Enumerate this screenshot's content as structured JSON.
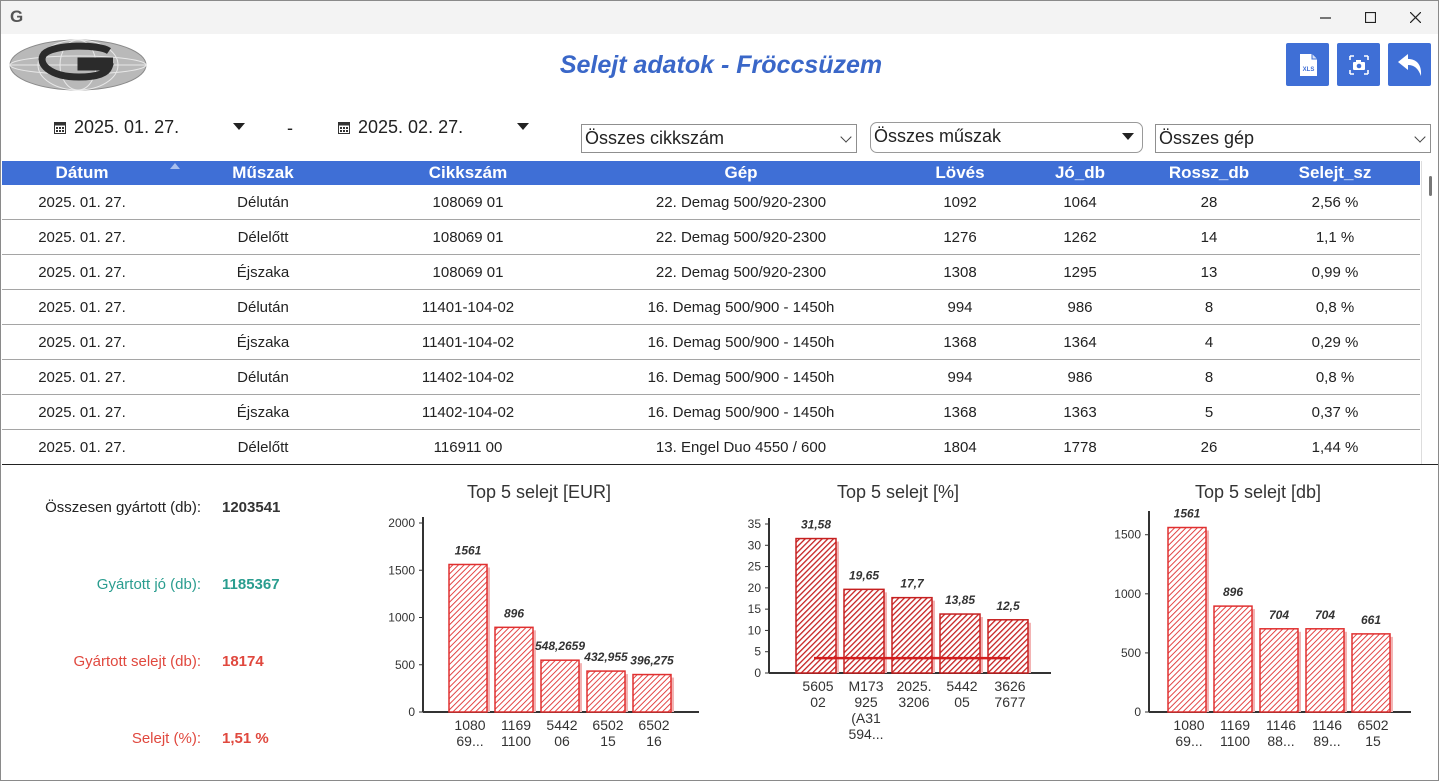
{
  "window": {
    "app_icon": "G",
    "minimize_icon": "minimize-icon",
    "maximize_icon": "maximize-icon",
    "close_icon": "close-icon"
  },
  "header": {
    "title": "Selejt adatok - Fröccsüzem",
    "logo": "company-globe-logo",
    "buttons": [
      {
        "name": "export-xls-button",
        "icon": "xls-icon",
        "label": "XLS"
      },
      {
        "name": "screenshot-button",
        "icon": "camera-icon"
      },
      {
        "name": "back-button",
        "icon": "undo-arrow-icon"
      }
    ],
    "accent_color": "#3f6fd6"
  },
  "filters": {
    "date_from": "2025. 01. 27.",
    "separator": "-",
    "date_to": "2025. 02. 27.",
    "part_number": "Összes cikkszám",
    "shift": "Összes műszak",
    "machine": "Összes gép"
  },
  "table": {
    "columns": [
      "Dátum",
      "Műszak",
      "Cikkszám",
      "Gép",
      "Lövés",
      "Jó_db",
      "Rossz_db",
      "Selejt_sz"
    ],
    "rows": [
      [
        "2025. 01. 27.",
        "Délután",
        "108069 01",
        "22. Demag 500/920-2300",
        "1092",
        "1064",
        "28",
        "2,56 %"
      ],
      [
        "2025. 01. 27.",
        "Délelőtt",
        "108069 01",
        "22. Demag 500/920-2300",
        "1276",
        "1262",
        "14",
        "1,1 %"
      ],
      [
        "2025. 01. 27.",
        "Éjszaka",
        "108069 01",
        "22. Demag 500/920-2300",
        "1308",
        "1295",
        "13",
        "0,99 %"
      ],
      [
        "2025. 01. 27.",
        "Délután",
        "11401-104-02",
        "16. Demag 500/900 - 1450h",
        "994",
        "986",
        "8",
        "0,8 %"
      ],
      [
        "2025. 01. 27.",
        "Éjszaka",
        "11401-104-02",
        "16. Demag 500/900 - 1450h",
        "1368",
        "1364",
        "4",
        "0,29 %"
      ],
      [
        "2025. 01. 27.",
        "Délután",
        "11402-104-02",
        "16. Demag 500/900 - 1450h",
        "994",
        "986",
        "8",
        "0,8 %"
      ],
      [
        "2025. 01. 27.",
        "Éjszaka",
        "11402-104-02",
        "16. Demag 500/900 - 1450h",
        "1368",
        "1363",
        "5",
        "0,37 %"
      ],
      [
        "2025. 01. 27.",
        "Délelőtt",
        "116911 00",
        "13. Engel Duo 4550 / 600",
        "1804",
        "1778",
        "26",
        "1,44 %"
      ]
    ]
  },
  "summary": {
    "total_label": "Összesen gyártott (db):",
    "total_value": "1203541",
    "good_label": "Gyártott jó (db):",
    "good_value": "1185367",
    "scrap_label": "Gyártott selejt (db):",
    "scrap_value": "18174",
    "pct_label": "Selejt (%):",
    "pct_value": "1,51 %",
    "colors": {
      "total": "#333333",
      "good": "#2a9d8f",
      "scrap": "#e0483e"
    }
  },
  "chart_data": [
    {
      "type": "bar",
      "title": "Top 5 selejt [EUR]",
      "categories": [
        [
          "1080",
          "69..."
        ],
        [
          "1169",
          "1100"
        ],
        [
          "5442",
          "06"
        ],
        [
          "6502",
          "15"
        ],
        [
          "6502",
          "16"
        ]
      ],
      "values": [
        1561,
        896,
        548.2659,
        432.955,
        396.275
      ],
      "labels": [
        "1561",
        "896",
        "548,2659",
        "432,955",
        "396,275"
      ],
      "yticks": [
        0,
        500,
        1000,
        1500,
        2000
      ],
      "ylim": [
        0,
        2000
      ],
      "bar_color": "#e03030"
    },
    {
      "type": "bar",
      "title": "Top 5 selejt [%]",
      "categories": [
        [
          "5605",
          "02"
        ],
        [
          "M173",
          "925",
          "(A31",
          "594..."
        ],
        [
          "2025.",
          "3206"
        ],
        [
          "5442",
          "05"
        ],
        [
          "3626",
          "7677"
        ]
      ],
      "values": [
        31.58,
        19.65,
        17.7,
        13.85,
        12.5
      ],
      "labels": [
        "31,58",
        "19,65",
        "17,7",
        "13,85",
        "12,5"
      ],
      "yticks": [
        0,
        5,
        10,
        15,
        20,
        25,
        30,
        35
      ],
      "ylim": [
        0,
        35
      ],
      "reference_line": 3.5,
      "bar_color": "#c62020"
    },
    {
      "type": "bar",
      "title": "Top 5 selejt [db]",
      "categories": [
        [
          "1080",
          "69..."
        ],
        [
          "1169",
          "1100"
        ],
        [
          "1146",
          "88..."
        ],
        [
          "1146",
          "89..."
        ],
        [
          "6502",
          "15"
        ]
      ],
      "values": [
        1561,
        896,
        704,
        704,
        661
      ],
      "labels": [
        "1561",
        "896",
        "704",
        "704",
        "661"
      ],
      "yticks": [
        0,
        500,
        1000,
        1500
      ],
      "ylim": [
        0,
        1650
      ],
      "bar_color": "#e03030"
    }
  ]
}
